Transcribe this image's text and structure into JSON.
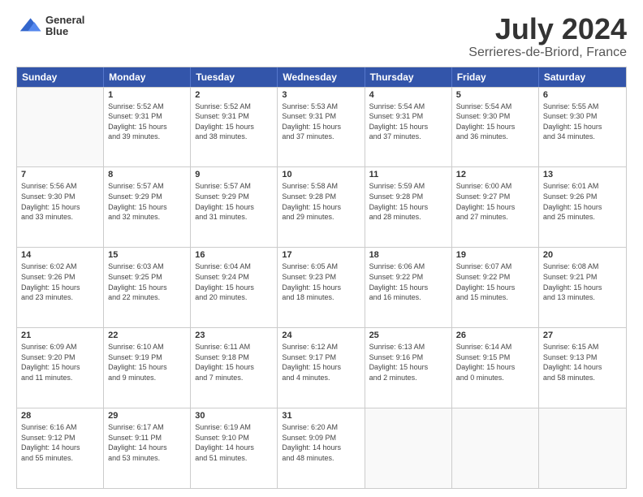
{
  "header": {
    "logo_line1": "General",
    "logo_line2": "Blue",
    "title": "July 2024",
    "subtitle": "Serrieres-de-Briord, France"
  },
  "calendar": {
    "days_of_week": [
      "Sunday",
      "Monday",
      "Tuesday",
      "Wednesday",
      "Thursday",
      "Friday",
      "Saturday"
    ],
    "weeks": [
      [
        {
          "day": "",
          "info": ""
        },
        {
          "day": "1",
          "info": "Sunrise: 5:52 AM\nSunset: 9:31 PM\nDaylight: 15 hours\nand 39 minutes."
        },
        {
          "day": "2",
          "info": "Sunrise: 5:52 AM\nSunset: 9:31 PM\nDaylight: 15 hours\nand 38 minutes."
        },
        {
          "day": "3",
          "info": "Sunrise: 5:53 AM\nSunset: 9:31 PM\nDaylight: 15 hours\nand 37 minutes."
        },
        {
          "day": "4",
          "info": "Sunrise: 5:54 AM\nSunset: 9:31 PM\nDaylight: 15 hours\nand 37 minutes."
        },
        {
          "day": "5",
          "info": "Sunrise: 5:54 AM\nSunset: 9:30 PM\nDaylight: 15 hours\nand 36 minutes."
        },
        {
          "day": "6",
          "info": "Sunrise: 5:55 AM\nSunset: 9:30 PM\nDaylight: 15 hours\nand 34 minutes."
        }
      ],
      [
        {
          "day": "7",
          "info": "Sunrise: 5:56 AM\nSunset: 9:30 PM\nDaylight: 15 hours\nand 33 minutes."
        },
        {
          "day": "8",
          "info": "Sunrise: 5:57 AM\nSunset: 9:29 PM\nDaylight: 15 hours\nand 32 minutes."
        },
        {
          "day": "9",
          "info": "Sunrise: 5:57 AM\nSunset: 9:29 PM\nDaylight: 15 hours\nand 31 minutes."
        },
        {
          "day": "10",
          "info": "Sunrise: 5:58 AM\nSunset: 9:28 PM\nDaylight: 15 hours\nand 29 minutes."
        },
        {
          "day": "11",
          "info": "Sunrise: 5:59 AM\nSunset: 9:28 PM\nDaylight: 15 hours\nand 28 minutes."
        },
        {
          "day": "12",
          "info": "Sunrise: 6:00 AM\nSunset: 9:27 PM\nDaylight: 15 hours\nand 27 minutes."
        },
        {
          "day": "13",
          "info": "Sunrise: 6:01 AM\nSunset: 9:26 PM\nDaylight: 15 hours\nand 25 minutes."
        }
      ],
      [
        {
          "day": "14",
          "info": "Sunrise: 6:02 AM\nSunset: 9:26 PM\nDaylight: 15 hours\nand 23 minutes."
        },
        {
          "day": "15",
          "info": "Sunrise: 6:03 AM\nSunset: 9:25 PM\nDaylight: 15 hours\nand 22 minutes."
        },
        {
          "day": "16",
          "info": "Sunrise: 6:04 AM\nSunset: 9:24 PM\nDaylight: 15 hours\nand 20 minutes."
        },
        {
          "day": "17",
          "info": "Sunrise: 6:05 AM\nSunset: 9:23 PM\nDaylight: 15 hours\nand 18 minutes."
        },
        {
          "day": "18",
          "info": "Sunrise: 6:06 AM\nSunset: 9:22 PM\nDaylight: 15 hours\nand 16 minutes."
        },
        {
          "day": "19",
          "info": "Sunrise: 6:07 AM\nSunset: 9:22 PM\nDaylight: 15 hours\nand 15 minutes."
        },
        {
          "day": "20",
          "info": "Sunrise: 6:08 AM\nSunset: 9:21 PM\nDaylight: 15 hours\nand 13 minutes."
        }
      ],
      [
        {
          "day": "21",
          "info": "Sunrise: 6:09 AM\nSunset: 9:20 PM\nDaylight: 15 hours\nand 11 minutes."
        },
        {
          "day": "22",
          "info": "Sunrise: 6:10 AM\nSunset: 9:19 PM\nDaylight: 15 hours\nand 9 minutes."
        },
        {
          "day": "23",
          "info": "Sunrise: 6:11 AM\nSunset: 9:18 PM\nDaylight: 15 hours\nand 7 minutes."
        },
        {
          "day": "24",
          "info": "Sunrise: 6:12 AM\nSunset: 9:17 PM\nDaylight: 15 hours\nand 4 minutes."
        },
        {
          "day": "25",
          "info": "Sunrise: 6:13 AM\nSunset: 9:16 PM\nDaylight: 15 hours\nand 2 minutes."
        },
        {
          "day": "26",
          "info": "Sunrise: 6:14 AM\nSunset: 9:15 PM\nDaylight: 15 hours\nand 0 minutes."
        },
        {
          "day": "27",
          "info": "Sunrise: 6:15 AM\nSunset: 9:13 PM\nDaylight: 14 hours\nand 58 minutes."
        }
      ],
      [
        {
          "day": "28",
          "info": "Sunrise: 6:16 AM\nSunset: 9:12 PM\nDaylight: 14 hours\nand 55 minutes."
        },
        {
          "day": "29",
          "info": "Sunrise: 6:17 AM\nSunset: 9:11 PM\nDaylight: 14 hours\nand 53 minutes."
        },
        {
          "day": "30",
          "info": "Sunrise: 6:19 AM\nSunset: 9:10 PM\nDaylight: 14 hours\nand 51 minutes."
        },
        {
          "day": "31",
          "info": "Sunrise: 6:20 AM\nSunset: 9:09 PM\nDaylight: 14 hours\nand 48 minutes."
        },
        {
          "day": "",
          "info": ""
        },
        {
          "day": "",
          "info": ""
        },
        {
          "day": "",
          "info": ""
        }
      ]
    ]
  }
}
